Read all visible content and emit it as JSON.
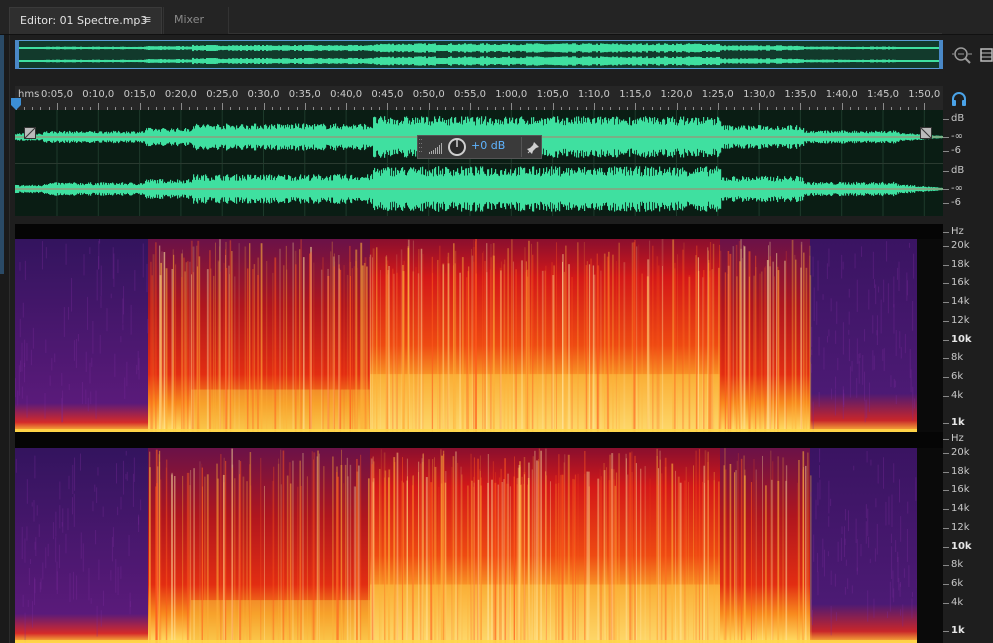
{
  "tabs": {
    "editor_label": "Editor: 01 Spectre.mp3",
    "menu_glyph": "≡",
    "mixer_label": "Mixer"
  },
  "ruler": {
    "unit": "hms",
    "labels": [
      "0:05,0",
      "0:10,0",
      "0:15,0",
      "0:20,0",
      "0:25,0",
      "0:30,0",
      "0:35,0",
      "0:40,0",
      "0:45,0",
      "0:50,0",
      "0:55,0",
      "1:00,0",
      "1:05,0",
      "1:10,0",
      "1:15,0",
      "1:20,0",
      "1:25,0",
      "1:30,0",
      "1:35,0",
      "1:40,0",
      "1:45,0",
      "1:50,0"
    ]
  },
  "hud": {
    "value_label": "+0 dB"
  },
  "waveform_scale": {
    "ch1": [
      "dB",
      "-∞",
      "-6"
    ],
    "ch2": [
      "dB",
      "-∞",
      "-6"
    ]
  },
  "spectral_scale": {
    "ch1": [
      "Hz",
      "20k",
      "18k",
      "16k",
      "14k",
      "12k",
      "10k",
      "8k",
      "6k",
      "4k",
      "1k"
    ],
    "ch2": [
      "Hz",
      "20k",
      "18k",
      "16k",
      "14k",
      "12k",
      "10k",
      "8k",
      "6k",
      "4k",
      "1k"
    ]
  },
  "colors": {
    "waveform": "#3fe0a0",
    "waveform_bg": "#0a1d14",
    "accent": "#4a88c7",
    "hud_value": "#5fb4ff",
    "spectral_low": "#3a1a6e",
    "spectral_mid": "#d41e1e",
    "spectral_high": "#ffd24a"
  },
  "icons": {
    "zoom": "zoom-selection-icon",
    "panel": "panel-toggle-icon",
    "headphone": "monitor-headphone-icon",
    "pin": "pin-icon",
    "meter": "level-meter-icon",
    "knob": "volume-knob-icon"
  }
}
